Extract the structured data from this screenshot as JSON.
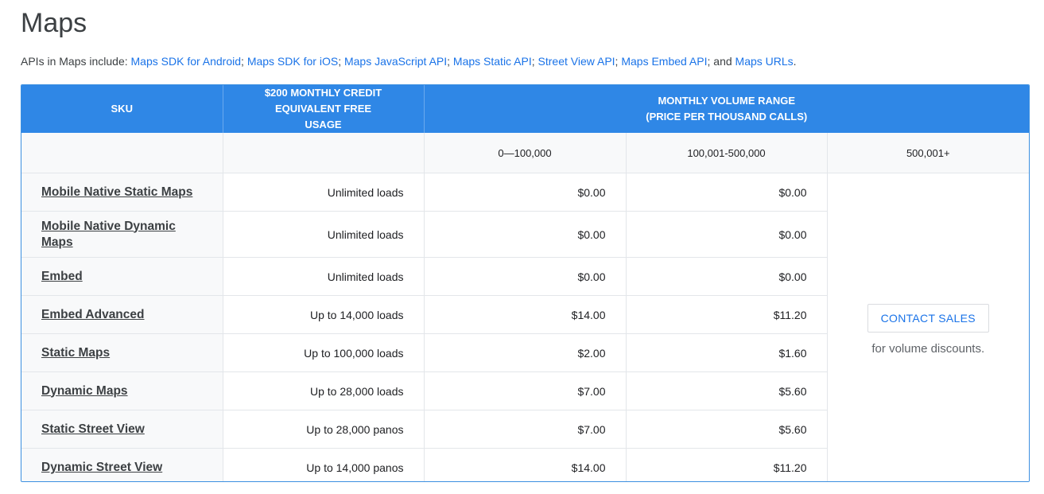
{
  "page": {
    "title": "Maps",
    "intro_prefix": "APIs in Maps include:",
    "intro_links": [
      "Maps SDK for Android",
      "Maps SDK for iOS",
      "Maps JavaScript API",
      "Maps Static API",
      "Street View API",
      "Maps Embed API",
      "Maps URLs"
    ],
    "intro_and": "and"
  },
  "table": {
    "headers": {
      "sku": "SKU",
      "credit": "$200 MONTHLY CREDIT EQUIVALENT FREE USAGE",
      "volume": "MONTHLY VOLUME RANGE (PRICE PER THOUSAND CALLS)"
    },
    "ranges": [
      "0—100,000",
      "100,001-500,000",
      "500,001+"
    ],
    "rows": [
      {
        "sku": "Mobile Native Static Maps",
        "free": "Unlimited loads",
        "tier1": "$0.00",
        "tier2": "$0.00"
      },
      {
        "sku": "Mobile Native Dynamic Maps",
        "free": "Unlimited loads",
        "tier1": "$0.00",
        "tier2": "$0.00"
      },
      {
        "sku": "Embed",
        "free": "Unlimited loads",
        "tier1": "$0.00",
        "tier2": "$0.00"
      },
      {
        "sku": "Embed Advanced",
        "free": "Up to 14,000 loads",
        "tier1": "$14.00",
        "tier2": "$11.20"
      },
      {
        "sku": "Static Maps",
        "free": "Up to 100,000 loads",
        "tier1": "$2.00",
        "tier2": "$1.60"
      },
      {
        "sku": "Dynamic Maps",
        "free": "Up to 28,000 loads",
        "tier1": "$7.00",
        "tier2": "$5.60"
      },
      {
        "sku": "Static Street View",
        "free": "Up to 28,000 panos",
        "tier1": "$7.00",
        "tier2": "$5.60"
      },
      {
        "sku": "Dynamic Street View",
        "free": "Up to 14,000 panos",
        "tier1": "$14.00",
        "tier2": "$11.20"
      }
    ],
    "contact": {
      "button_label": "CONTACT SALES",
      "note": "for volume discounts."
    }
  },
  "colors": {
    "header_bg": "#2f87e6",
    "link": "#1a73e8",
    "subheader_bg": "#f8f9fa"
  }
}
